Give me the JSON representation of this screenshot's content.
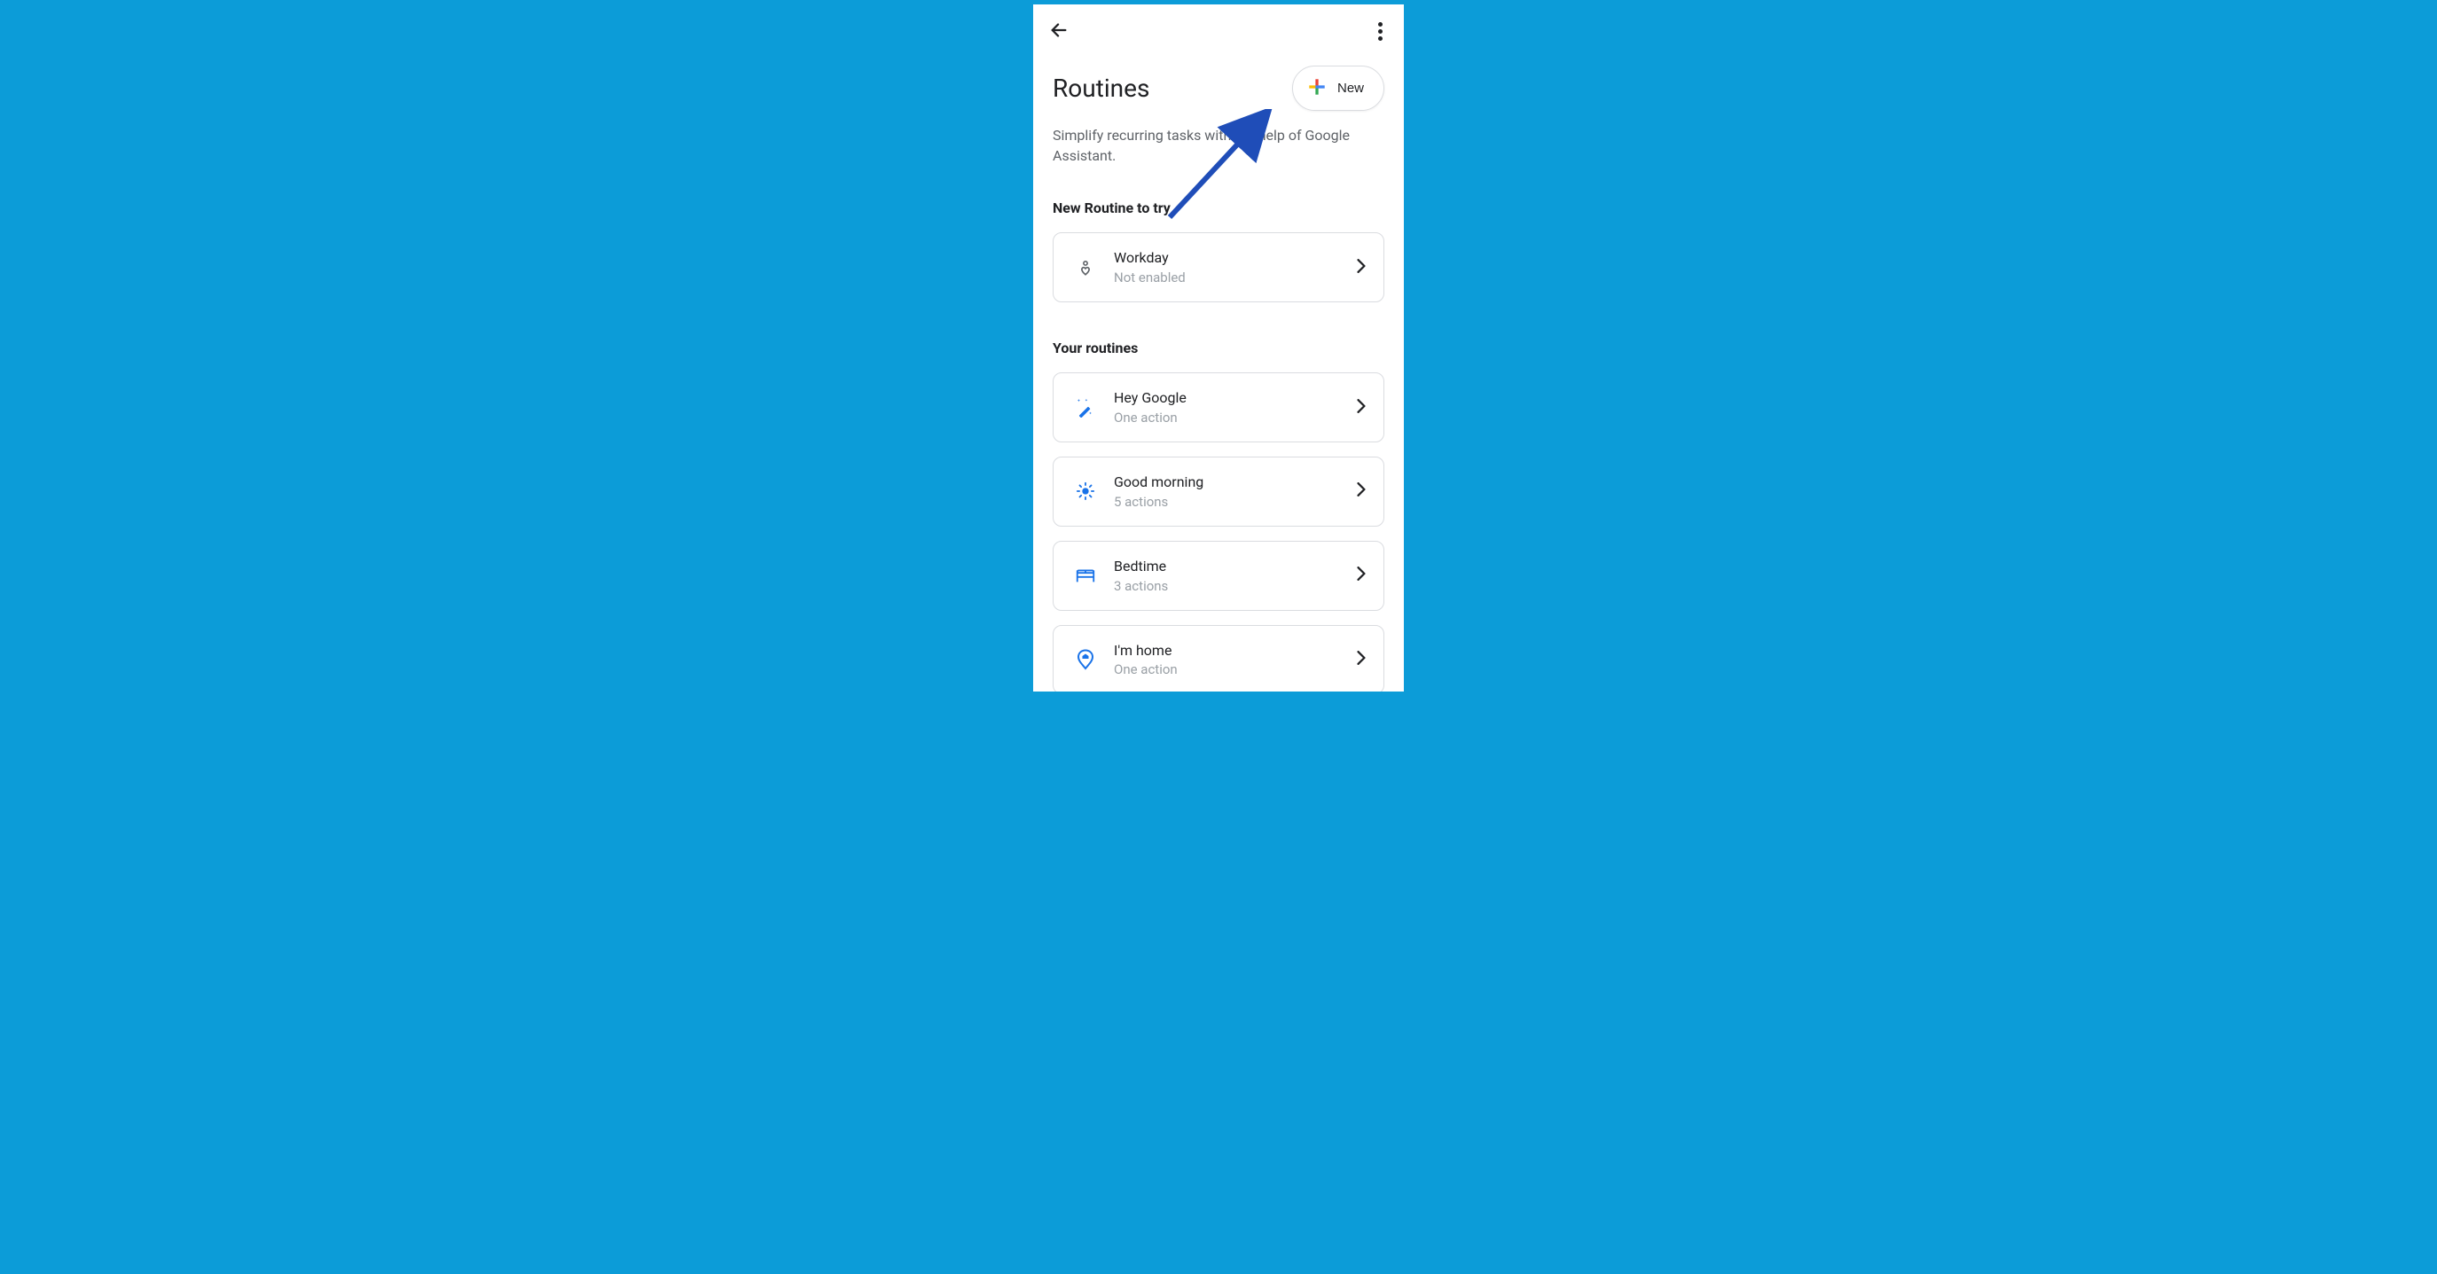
{
  "header": {
    "title": "Routines",
    "new_button_label": "New",
    "description": "Simplify recurring tasks with the help of Google Assistant."
  },
  "sections": {
    "try": {
      "title": "New Routine to try",
      "items": [
        {
          "title": "Workday",
          "subtitle": "Not enabled",
          "icon": "person-heart"
        }
      ]
    },
    "yours": {
      "title": "Your routines",
      "items": [
        {
          "title": "Hey Google",
          "subtitle": "One action",
          "icon": "wand"
        },
        {
          "title": "Good morning",
          "subtitle": "5 actions",
          "icon": "sun"
        },
        {
          "title": "Bedtime",
          "subtitle": "3 actions",
          "icon": "bed"
        },
        {
          "title": "I'm home",
          "subtitle": "One action",
          "icon": "home-pin"
        }
      ]
    }
  }
}
